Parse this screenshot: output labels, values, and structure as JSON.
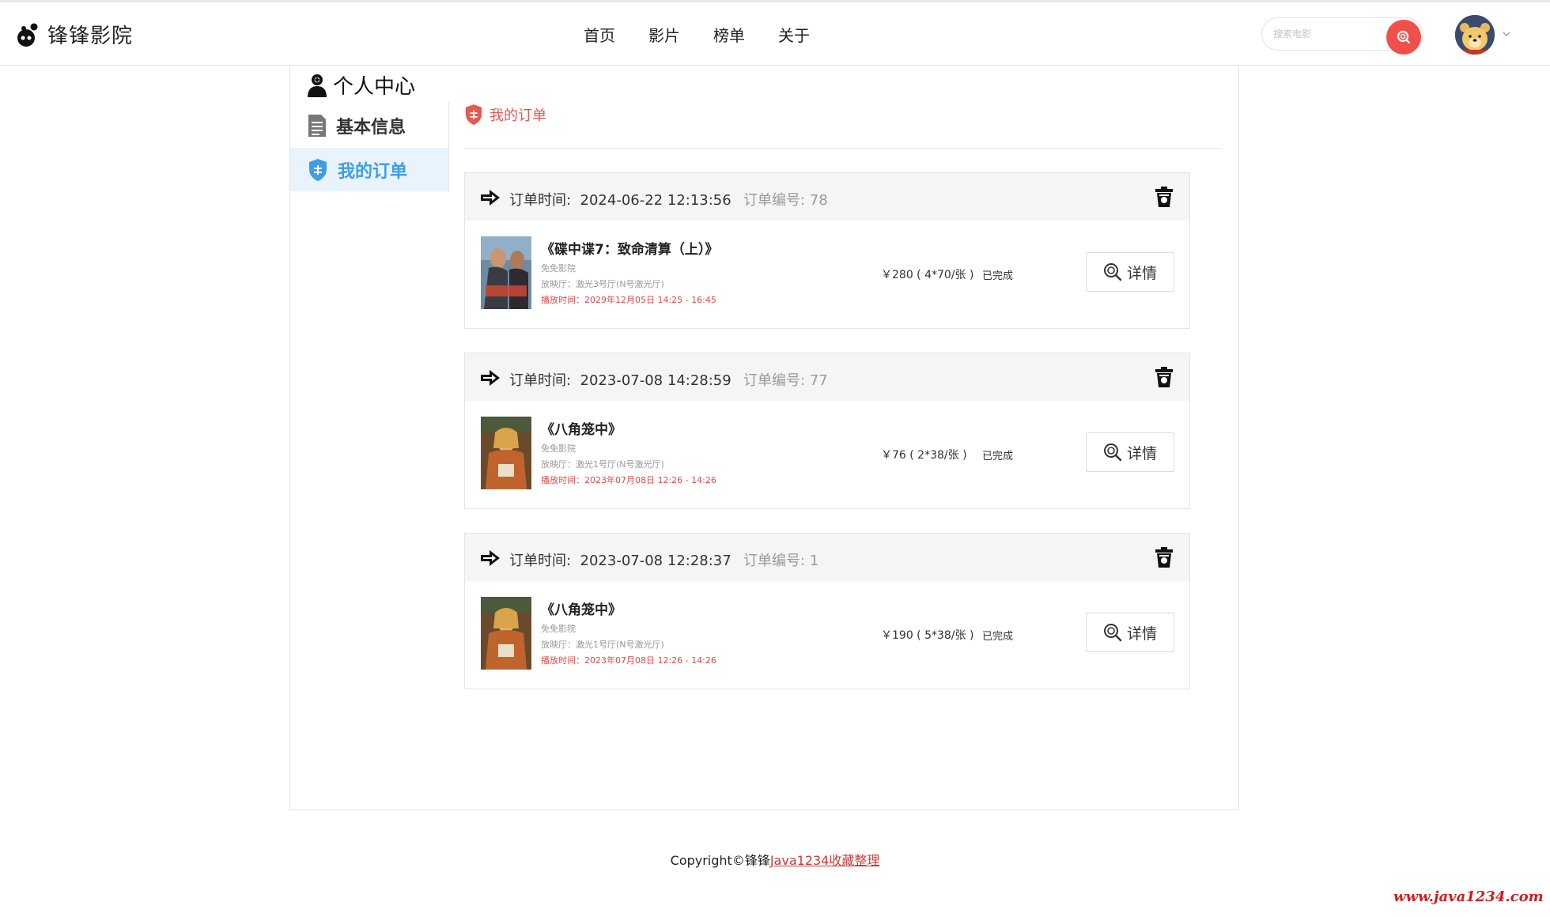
{
  "header": {
    "logo_text": "锋锋影院",
    "nav": [
      "首页",
      "影片",
      "榜单",
      "关于"
    ],
    "search_placeholder": "搜索电影"
  },
  "sidebar": {
    "title": "个人中心",
    "items": [
      {
        "label": "基本信息",
        "icon": "document-icon",
        "active": false
      },
      {
        "label": "我的订单",
        "icon": "shield-icon",
        "active": true
      }
    ]
  },
  "main": {
    "section_title": "我的订单",
    "order_time_prefix": "订单时间:",
    "order_no_prefix": "订单编号:",
    "detail_label": "详情",
    "orders": [
      {
        "time": "2024-06-22 12:13:56",
        "order_no": "78",
        "movie": "《碟中谍7：致命清算（上）》",
        "cinema": "免免影院",
        "hall": "放映厅：激光3号厅(N号激光厅)",
        "showtime": "播放时间：2029年12月05日 14:25 - 16:45",
        "price": "￥280 ( 4*70/张 )",
        "status": "已完成"
      },
      {
        "time": "2023-07-08 14:28:59",
        "order_no": "77",
        "movie": "《八角笼中》",
        "cinema": "免免影院",
        "hall": "放映厅：激光1号厅(N号激光厅)",
        "showtime": "播放时间：2023年07月08日 12:26 - 14:26",
        "price": "￥76 ( 2*38/张 )",
        "status": "已完成"
      },
      {
        "time": "2023-07-08 12:28:37",
        "order_no": "1",
        "movie": "《八角笼中》",
        "cinema": "免免影院",
        "hall": "放映厅：激光1号厅(N号激光厅)",
        "showtime": "播放时间：2023年07月08日 12:26 - 14:26",
        "price": "￥190 ( 5*38/张 )",
        "status": "已完成"
      }
    ]
  },
  "footer": {
    "copyright": "Copyright©锋锋",
    "link_text": "Java1234收藏整理"
  },
  "watermark": "www.java1234.com",
  "colors": {
    "accent_red": "#f1504a",
    "active_blue": "#3e9de6",
    "showtime_red": "#e04848"
  }
}
